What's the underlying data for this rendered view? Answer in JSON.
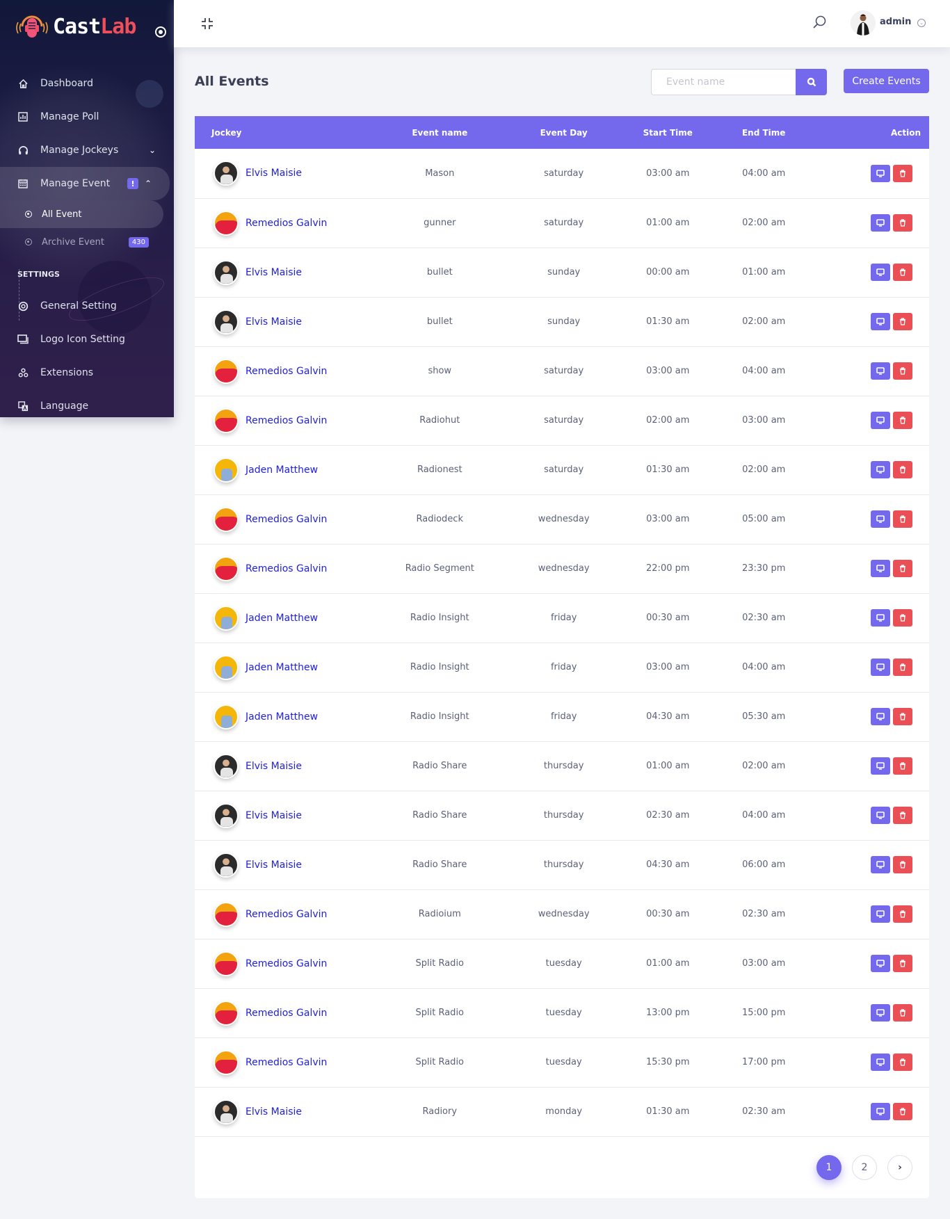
{
  "brand": {
    "name_part1": "Cast",
    "name_part2": "Lab"
  },
  "sidebar": {
    "items": [
      {
        "label": "Dashboard",
        "icon": "home-icon"
      },
      {
        "label": "Manage Poll",
        "icon": "poll-chart-icon"
      },
      {
        "label": "Manage Jockeys",
        "icon": "headphones-icon"
      },
      {
        "label": "Manage Event",
        "icon": "calendar-icon",
        "badge": "!"
      }
    ],
    "sub_items": [
      {
        "label": "All Event",
        "active": true
      },
      {
        "label": "Archive Event",
        "count": "430"
      }
    ],
    "section_title": "SETTINGS",
    "settings_items": [
      {
        "label": "General Setting",
        "icon": "settings-icon"
      },
      {
        "label": "Logo Icon Setting",
        "icon": "images-icon"
      },
      {
        "label": "Extensions",
        "icon": "extensions-icon"
      },
      {
        "label": "Language",
        "icon": "language-icon"
      }
    ]
  },
  "topbar": {
    "user_name": "admin"
  },
  "page": {
    "title": "All Events",
    "search_placeholder": "Event name",
    "search_value": "",
    "create_label": "Create Events"
  },
  "table": {
    "headers": {
      "jockey": "Jockey",
      "event": "Event name",
      "day": "Event Day",
      "start": "Start Time",
      "end": "End Time",
      "action": "Action"
    },
    "rows": [
      {
        "jockey": "Elvis Maisie",
        "avatar": "elvis",
        "event": "Mason",
        "day": "saturday",
        "start": "03:00 am",
        "end": "04:00 am"
      },
      {
        "jockey": "Remedios Galvin",
        "avatar": "remedios",
        "event": "gunner",
        "day": "saturday",
        "start": "01:00 am",
        "end": "02:00 am"
      },
      {
        "jockey": "Elvis Maisie",
        "avatar": "elvis",
        "event": "bullet",
        "day": "sunday",
        "start": "00:00 am",
        "end": "01:00 am"
      },
      {
        "jockey": "Elvis Maisie",
        "avatar": "elvis",
        "event": "bullet",
        "day": "sunday",
        "start": "01:30 am",
        "end": "02:00 am"
      },
      {
        "jockey": "Remedios Galvin",
        "avatar": "remedios",
        "event": "show",
        "day": "saturday",
        "start": "03:00 am",
        "end": "04:00 am"
      },
      {
        "jockey": "Remedios Galvin",
        "avatar": "remedios",
        "event": "Radiohut",
        "day": "saturday",
        "start": "02:00 am",
        "end": "03:00 am"
      },
      {
        "jockey": "Jaden Matthew",
        "avatar": "jaden",
        "event": "Radionest",
        "day": "saturday",
        "start": "01:30 am",
        "end": "02:00 am"
      },
      {
        "jockey": "Remedios Galvin",
        "avatar": "remedios",
        "event": "Radiodeck",
        "day": "wednesday",
        "start": "03:00 am",
        "end": "05:00 am"
      },
      {
        "jockey": "Remedios Galvin",
        "avatar": "remedios",
        "event": "Radio Segment",
        "day": "wednesday",
        "start": "22:00 pm",
        "end": "23:30 pm"
      },
      {
        "jockey": "Jaden Matthew",
        "avatar": "jaden",
        "event": "Radio Insight",
        "day": "friday",
        "start": "00:30 am",
        "end": "02:30 am"
      },
      {
        "jockey": "Jaden Matthew",
        "avatar": "jaden",
        "event": "Radio Insight",
        "day": "friday",
        "start": "03:00 am",
        "end": "04:00 am"
      },
      {
        "jockey": "Jaden Matthew",
        "avatar": "jaden",
        "event": "Radio Insight",
        "day": "friday",
        "start": "04:30 am",
        "end": "05:30 am"
      },
      {
        "jockey": "Elvis Maisie",
        "avatar": "elvis",
        "event": "Radio Share",
        "day": "thursday",
        "start": "01:00 am",
        "end": "02:00 am"
      },
      {
        "jockey": "Elvis Maisie",
        "avatar": "elvis",
        "event": "Radio Share",
        "day": "thursday",
        "start": "02:30 am",
        "end": "04:00 am"
      },
      {
        "jockey": "Elvis Maisie",
        "avatar": "elvis",
        "event": "Radio Share",
        "day": "thursday",
        "start": "04:30 am",
        "end": "06:00 am"
      },
      {
        "jockey": "Remedios Galvin",
        "avatar": "remedios",
        "event": "Radioium",
        "day": "wednesday",
        "start": "00:30 am",
        "end": "02:30 am"
      },
      {
        "jockey": "Remedios Galvin",
        "avatar": "remedios",
        "event": "Split Radio",
        "day": "tuesday",
        "start": "01:00 am",
        "end": "03:00 am"
      },
      {
        "jockey": "Remedios Galvin",
        "avatar": "remedios",
        "event": "Split Radio",
        "day": "tuesday",
        "start": "13:00 pm",
        "end": "15:00 pm"
      },
      {
        "jockey": "Remedios Galvin",
        "avatar": "remedios",
        "event": "Split Radio",
        "day": "tuesday",
        "start": "15:30 pm",
        "end": "17:00 pm"
      },
      {
        "jockey": "Elvis Maisie",
        "avatar": "elvis",
        "event": "Radiory",
        "day": "monday",
        "start": "01:30 am",
        "end": "02:30 am"
      }
    ]
  },
  "pagination": {
    "pages": [
      "1",
      "2"
    ],
    "current": "1",
    "next": "›"
  },
  "colors": {
    "accent": "#7468ec",
    "danger": "#ea4f55",
    "link": "#2020e0",
    "brand_red": "#ef4f5a"
  }
}
